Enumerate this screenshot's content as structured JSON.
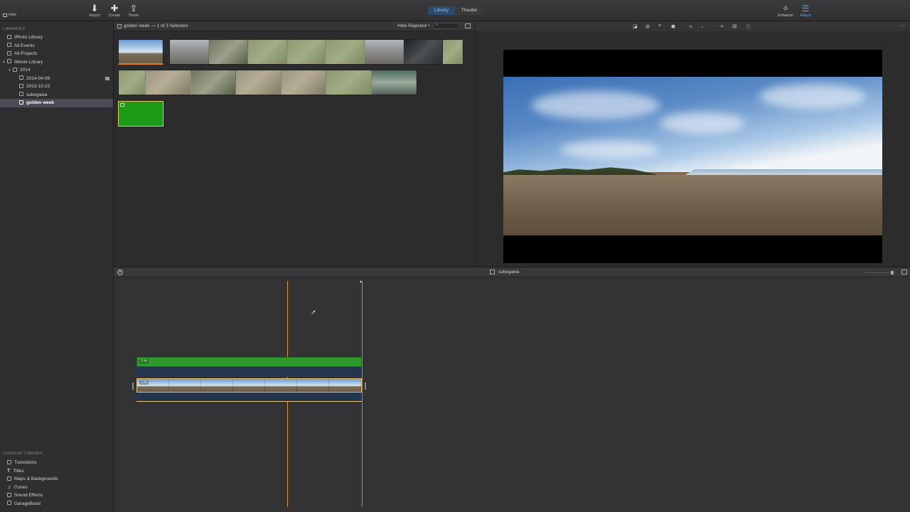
{
  "toolbar": {
    "hide_label": "Hide",
    "import_label": "Import",
    "create_label": "Create",
    "share_label": "Share",
    "mode_library": "Library",
    "mode_theater": "Theater",
    "enhance_label": "Enhance",
    "adjust_label": "Adjust"
  },
  "sidebar": {
    "libraries_heading": "LIBRARIES",
    "items": [
      {
        "label": "iPhoto Library"
      },
      {
        "label": "All Events"
      },
      {
        "label": "All Projects"
      },
      {
        "label": "iMovie Library"
      },
      {
        "label": "2014"
      },
      {
        "label": "2014-04-06"
      },
      {
        "label": "2013-10-23"
      },
      {
        "label": "sukegawa"
      },
      {
        "label": "golden week"
      }
    ],
    "content_heading": "CONTENT LIBRARY",
    "content_items": [
      {
        "label": "Transitions"
      },
      {
        "label": "Titles"
      },
      {
        "label": "Maps & Backgrounds"
      },
      {
        "label": "iTunes"
      },
      {
        "label": "Sound Effects"
      },
      {
        "label": "GarageBand"
      }
    ]
  },
  "browser": {
    "event_title": "golden week — 1 of 3 Selected",
    "filter_label": "Hide Rejected ÷"
  },
  "timeline": {
    "project_title": "sukegawa",
    "green_duration": "3.4s",
    "video_duration": "3.4s"
  },
  "colors": {
    "accent_blue": "#2c4a6e",
    "selection_yellow": "#e8c56b",
    "playhead_orange": "#e0953a",
    "green_clip": "#2e9a2b"
  }
}
